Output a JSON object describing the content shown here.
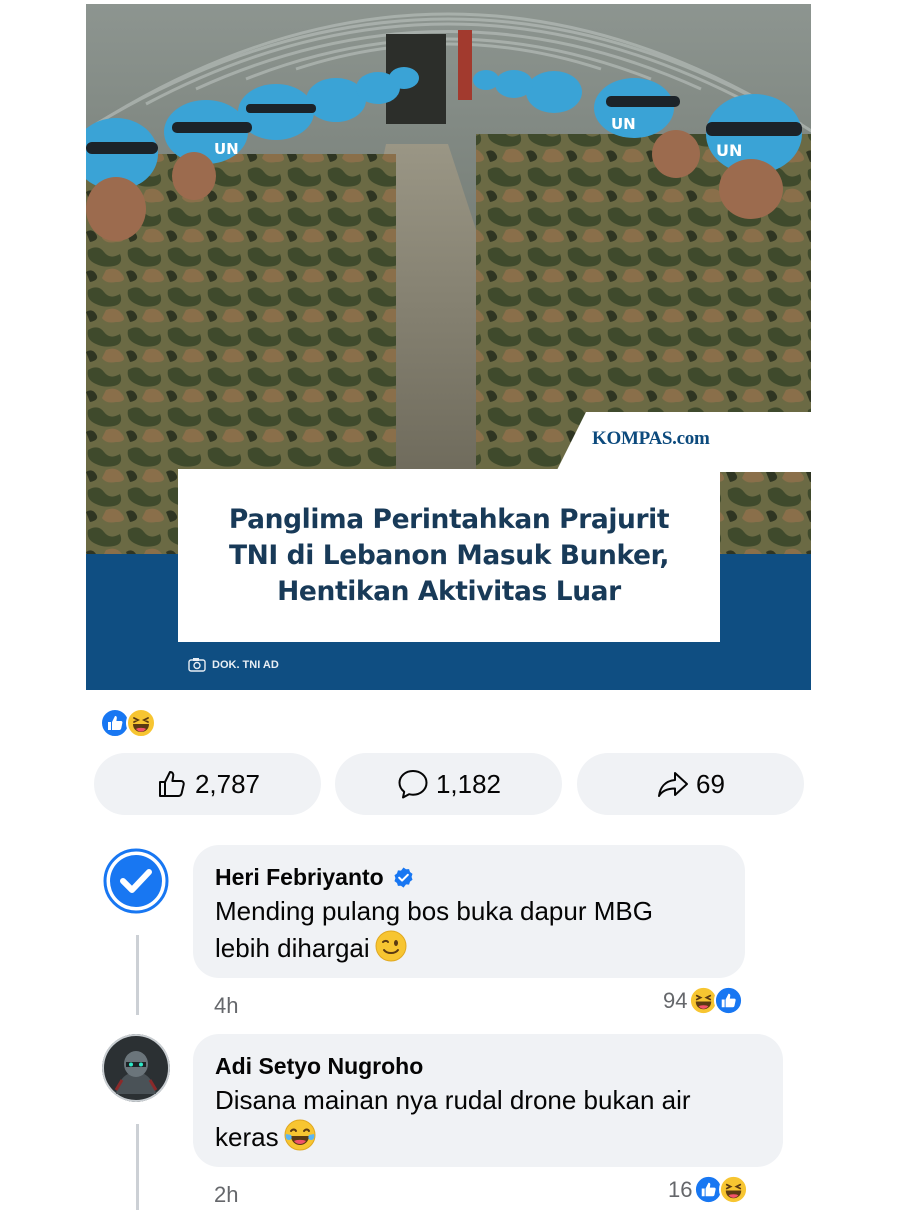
{
  "post": {
    "image": {
      "brand": "KOMPAS.com",
      "headline_lines": [
        "Panglima Perintahkan Prajurit",
        "TNI di Lebanon Masuk Bunker,",
        "Hentikan Aktivitas Luar"
      ],
      "photo_credit": "DOK. TNI AD",
      "helmet_text": "UN"
    },
    "reactions_summary": [
      "like",
      "haha"
    ],
    "actions": {
      "like_count": "2,787",
      "comment_count": "1,182",
      "share_count": "69"
    }
  },
  "comments": [
    {
      "author": "Heri Febriyanto",
      "verified": true,
      "text_line1": "Mending pulang bos buka dapur MBG",
      "text_line2": "lebih dihargai",
      "emoji": "winking-face",
      "time": "4h",
      "reaction_count": "94",
      "reactions": [
        "haha",
        "like"
      ]
    },
    {
      "author": "Adi Setyo Nugroho",
      "verified": false,
      "text_line1": "Disana mainan nya rudal drone bukan air",
      "text_line2": "keras",
      "emoji": "tears-of-joy",
      "time": "2h",
      "reaction_count": "16",
      "reactions": [
        "like",
        "haha"
      ]
    }
  ],
  "colors": {
    "brand_blue": "#0c4a7d",
    "headline_navy": "#183a58",
    "fb_blue": "#1877f2",
    "pill_bg": "#f0f2f5",
    "meta_gray": "#65676b",
    "un_blue": "#3aa3d6"
  }
}
